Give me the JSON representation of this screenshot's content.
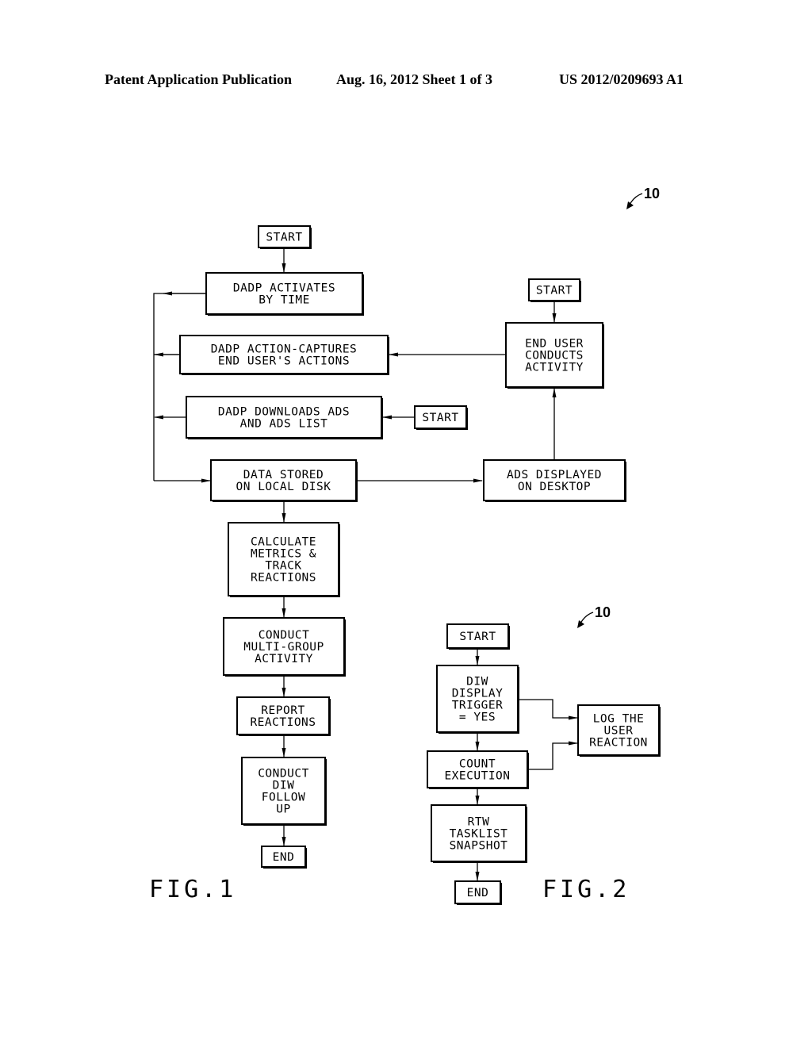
{
  "header": {
    "publication": "Patent Application Publication",
    "date_sheet": "Aug. 16, 2012  Sheet 1 of 3",
    "patent_number": "US 2012/0209693 A1"
  },
  "fig1": {
    "label": "FIG.1",
    "ref": "10",
    "boxes": {
      "start_main": [
        "START"
      ],
      "dadp_activates": [
        "DADP ACTIVATES",
        "BY TIME"
      ],
      "dadp_action_captures": [
        "DADP ACTION-CAPTURES",
        "END USER'S ACTIONS"
      ],
      "dadp_downloads": [
        "DADP DOWNLOADS ADS",
        "AND ADS LIST"
      ],
      "start_downloads": [
        "START"
      ],
      "data_stored": [
        "DATA STORED",
        "ON LOCAL DISK"
      ],
      "ads_displayed": [
        "ADS DISPLAYED",
        "ON DESKTOP"
      ],
      "start_user": [
        "START"
      ],
      "end_user_conducts": [
        "END USER",
        "CONDUCTS",
        "ACTIVITY"
      ],
      "calculate_metrics": [
        "CALCULATE",
        "METRICS &",
        "TRACK",
        "REACTIONS"
      ],
      "multi_group": [
        "CONDUCT",
        "MULTI-GROUP",
        "ACTIVITY"
      ],
      "report_reactions": [
        "REPORT",
        "REACTIONS"
      ],
      "diw_follow_up": [
        "CONDUCT",
        "DIW",
        "FOLLOW",
        "UP"
      ],
      "end": [
        "END"
      ]
    }
  },
  "fig2": {
    "label": "FIG.2",
    "ref": "10",
    "boxes": {
      "start": [
        "START"
      ],
      "diw_trigger": [
        "DIW",
        "DISPLAY",
        "TRIGGER",
        "= YES"
      ],
      "count_execution": [
        "COUNT",
        "EXECUTION"
      ],
      "log_reaction": [
        "LOG THE",
        "USER",
        "REACTION"
      ],
      "rtw_snapshot": [
        "RTW",
        "TASKLIST",
        "SNAPSHOT"
      ],
      "end": [
        "END"
      ]
    }
  }
}
